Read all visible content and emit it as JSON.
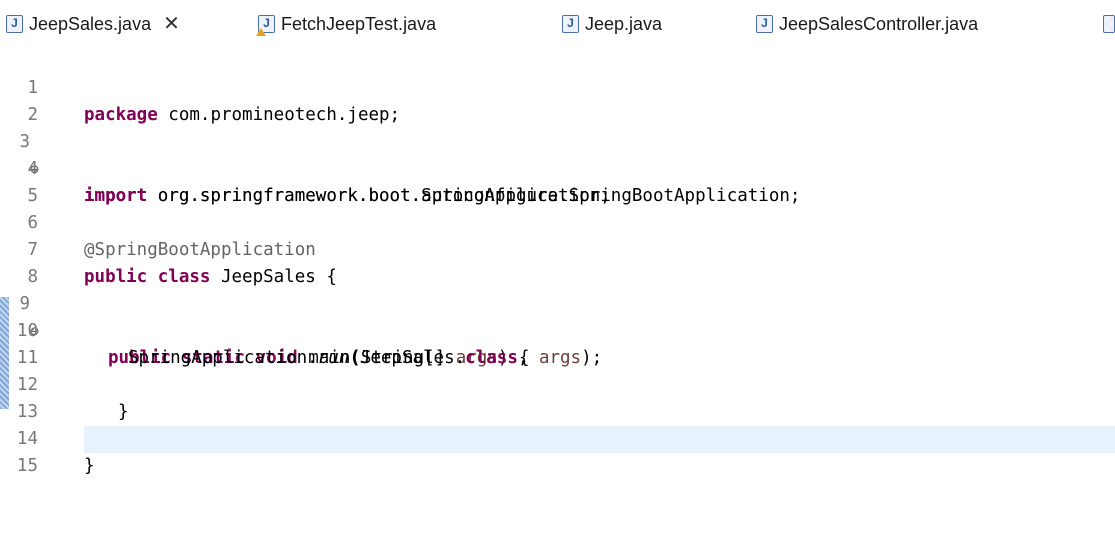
{
  "tabs": [
    {
      "label": "JeepSales.java",
      "active": true,
      "icon": "java-file-icon",
      "close": "✕"
    },
    {
      "label": "FetchJeepTest.java",
      "icon": "java-file-warning-icon"
    },
    {
      "label": "Jeep.java",
      "icon": "java-file-icon"
    },
    {
      "label": "JeepSalesController.java",
      "icon": "java-file-icon"
    }
  ],
  "icon_glyph": "J",
  "fold_glyph": "⊖",
  "line_numbers": [
    "1",
    "2",
    "3",
    "4",
    "5",
    "6",
    "7",
    "8",
    "9",
    "10",
    "11",
    "12",
    "13",
    "14",
    "15"
  ],
  "code": {
    "l1_kw": "package",
    "l1_rest": " com.promineotech.jeep;",
    "l3_kw": "import",
    "l3_rest": " org.springframework.boot.SpringApplication;",
    "l4_kw": "import",
    "l4_rest": " org.springframework.boot.autoconfigure.SpringBootApplication;",
    "l6_ann": "@SpringBootApplication",
    "l7_kw1": "public",
    "l7_kw2": "class",
    "l7_rest": " JeepSales {",
    "l9_kw1": "public",
    "l9_kw2": "static",
    "l9_kw3": "void",
    "l9_rest1": " main(String[] ",
    "l9_var": "args",
    "l9_rest2": ") {",
    "l10_pre": "SpringApplication.",
    "l10_method": "run",
    "l10_mid": "(JeepSales.",
    "l10_kw": "class",
    "l10_sep": ", ",
    "l10_var": "args",
    "l10_end": ");",
    "l12": "}",
    "l14": "}"
  },
  "colors": {
    "keyword": "#7f0055",
    "annotation": "#646464",
    "variable": "#6a3e3e",
    "line_number": "#787878",
    "current_line": "#e8f2fe"
  }
}
